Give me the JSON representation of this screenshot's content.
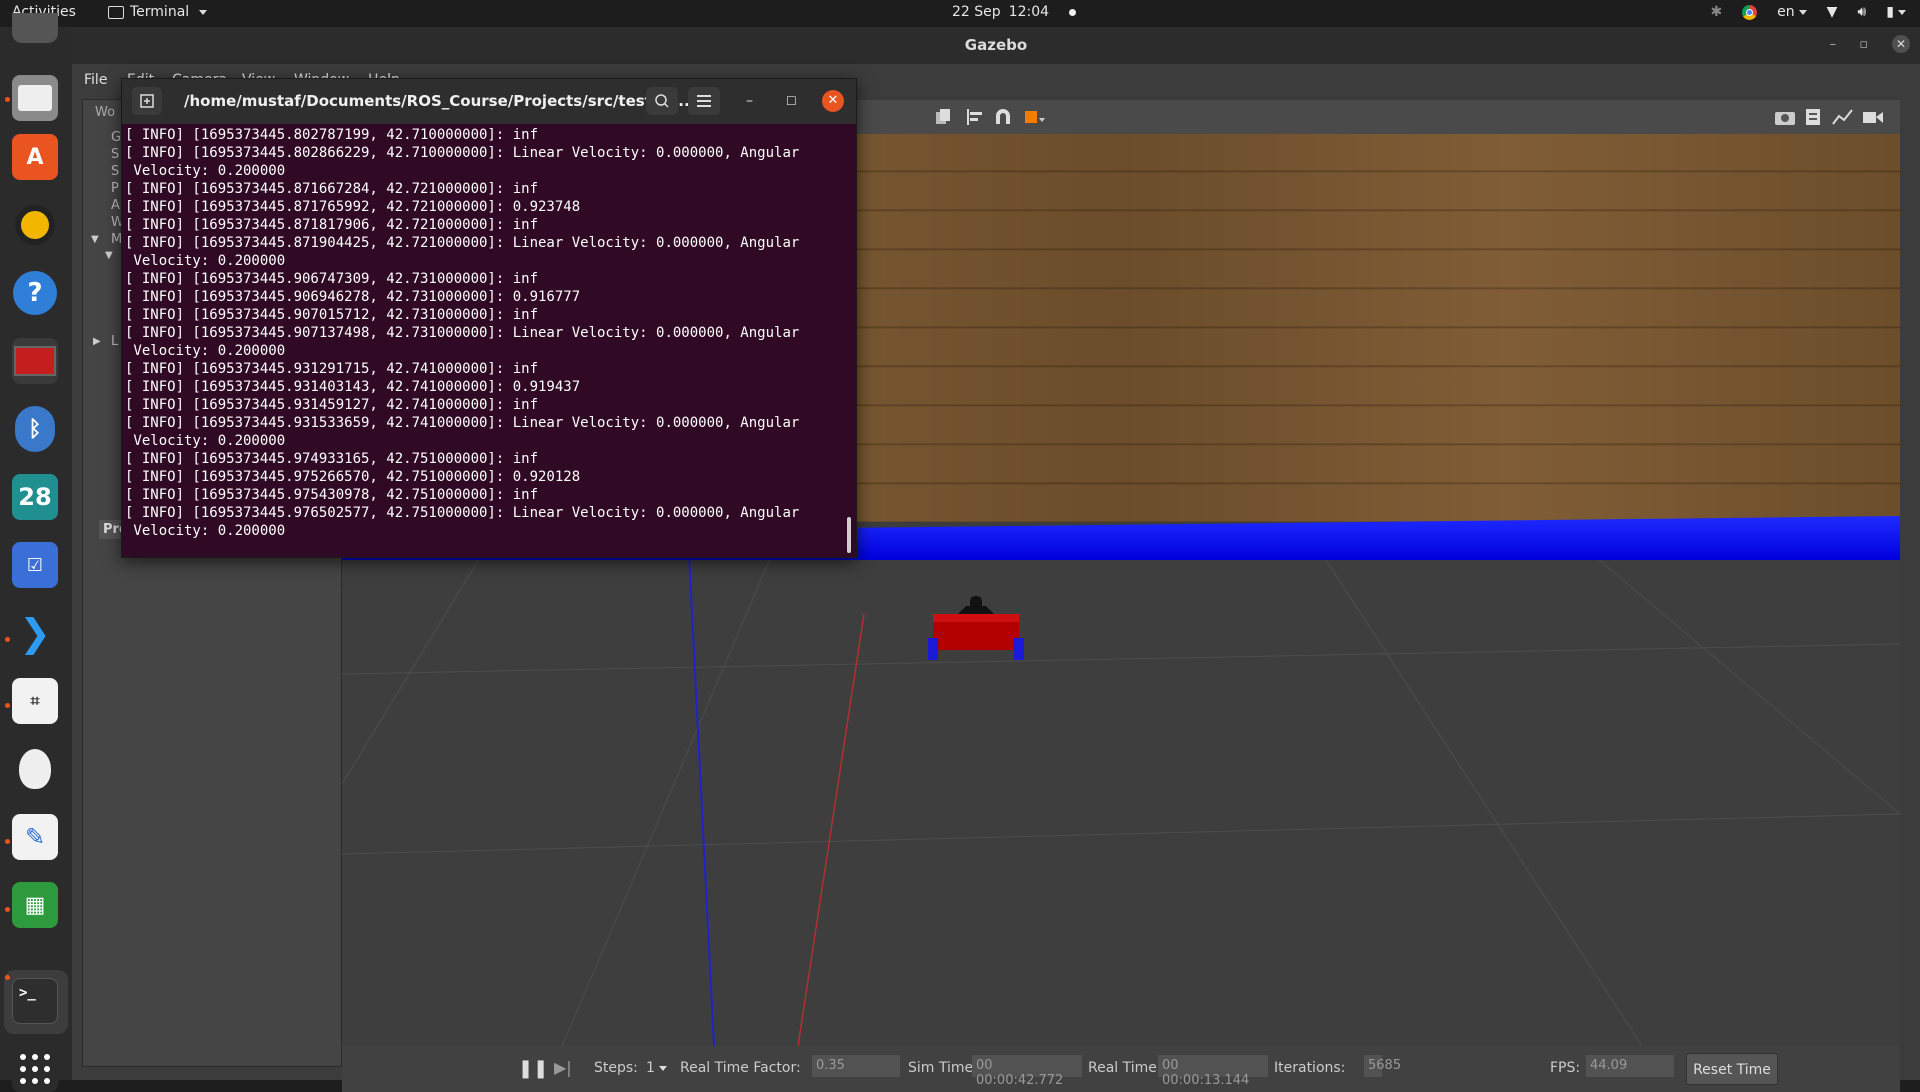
{
  "topbar": {
    "activities": "Activities",
    "app_menu": "Terminal",
    "date": "22 Sep",
    "time": "12:04",
    "language": "en"
  },
  "dock": {
    "items": [
      "files-icon",
      "software-icon",
      "rhythmbox-icon",
      "help-icon",
      "system-monitor-icon",
      "bluetooth-icon",
      "calendar-icon",
      "tasks-icon",
      "vscode-icon",
      "reader-icon",
      "egg-icon",
      "text-editor-icon",
      "spreadsheet-icon",
      "terminal-icon",
      "app-grid-icon"
    ],
    "calendar_day": "28"
  },
  "gazebo": {
    "title": "Gazebo",
    "menu": [
      "File",
      "Edit",
      "Camera",
      "View",
      "Window",
      "Help"
    ],
    "left_panel": {
      "title": "Wo",
      "tree": [
        "G",
        "S",
        "S",
        "P",
        "A",
        "W",
        "M",
        "L"
      ],
      "props_label": "Prop"
    },
    "statusbar": {
      "steps_label": "Steps:",
      "steps_value": "1",
      "rtf_label": "Real Time Factor:",
      "rtf_value": "0.35",
      "sim_time_label": "Sim Time:",
      "sim_time_value": "00 00:00:42.772",
      "real_time_label": "Real Time:",
      "real_time_value": "00 00:00:13.144",
      "iterations_label": "Iterations:",
      "iterations_value": "5685",
      "fps_label": "FPS:",
      "fps_value": "44.09",
      "reset_label": "Reset Time"
    }
  },
  "terminal": {
    "title": "/home/mustaf/Documents/ROS_Course/Projects/src/test/la...",
    "lines": [
      "[ INFO] [1695373445.802787199, 42.710000000]: inf",
      "[ INFO] [1695373445.802866229, 42.710000000]: Linear Velocity: 0.000000, Angular",
      " Velocity: 0.200000",
      "[ INFO] [1695373445.871667284, 42.721000000]: inf",
      "[ INFO] [1695373445.871765992, 42.721000000]: 0.923748",
      "[ INFO] [1695373445.871817906, 42.721000000]: inf",
      "[ INFO] [1695373445.871904425, 42.721000000]: Linear Velocity: 0.000000, Angular",
      " Velocity: 0.200000",
      "[ INFO] [1695373445.906747309, 42.731000000]: inf",
      "[ INFO] [1695373445.906946278, 42.731000000]: 0.916777",
      "[ INFO] [1695373445.907015712, 42.731000000]: inf",
      "[ INFO] [1695373445.907137498, 42.731000000]: Linear Velocity: 0.000000, Angular",
      " Velocity: 0.200000",
      "[ INFO] [1695373445.931291715, 42.741000000]: inf",
      "[ INFO] [1695373445.931403143, 42.741000000]: 0.919437",
      "[ INFO] [1695373445.931459127, 42.741000000]: inf",
      "[ INFO] [1695373445.931533659, 42.741000000]: Linear Velocity: 0.000000, Angular",
      " Velocity: 0.200000",
      "[ INFO] [1695373445.974933165, 42.751000000]: inf",
      "[ INFO] [1695373445.975266570, 42.751000000]: 0.920128",
      "[ INFO] [1695373445.975430978, 42.751000000]: inf",
      "[ INFO] [1695373445.976502577, 42.751000000]: Linear Velocity: 0.000000, Angular",
      " Velocity: 0.200000"
    ]
  },
  "colors": {
    "terminal_bg": "#300a24",
    "accent": "#e95420",
    "floor_blue": "#0000dc",
    "robot_red": "#b30000"
  }
}
